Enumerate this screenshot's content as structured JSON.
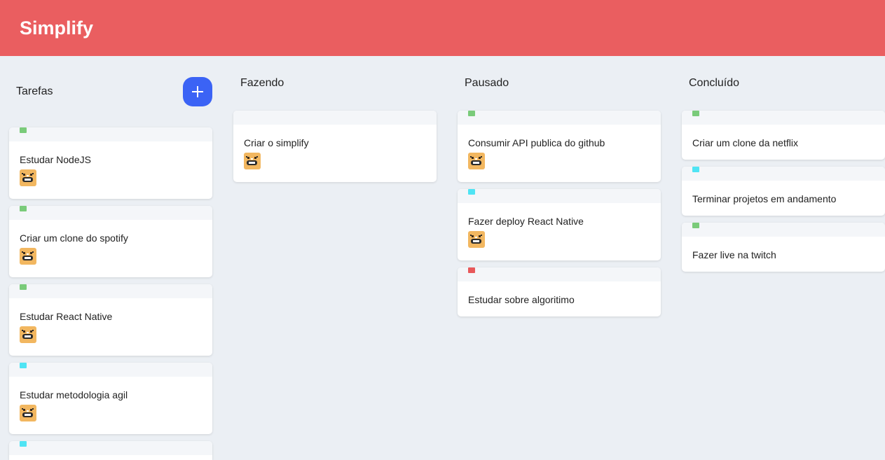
{
  "app": {
    "title": "Simplify"
  },
  "colors": {
    "header": "#ea5e60",
    "background": "#ebeff4",
    "add_button": "#3b63f5",
    "tag_green": "#7acb7a",
    "tag_cyan": "#4fe4f4",
    "tag_red": "#e8585a",
    "avatar": "#f2b760"
  },
  "columns": [
    {
      "title": "Tarefas",
      "add_button_icon": "plus-icon",
      "cards": [
        {
          "text": "Estudar NodeJS",
          "tag": "green",
          "has_avatar": true
        },
        {
          "text": "Criar um clone do spotify",
          "tag": "green",
          "has_avatar": true
        },
        {
          "text": "Estudar React Native",
          "tag": "green",
          "has_avatar": true
        },
        {
          "text": "Estudar metodologia agil",
          "tag": "cyan",
          "has_avatar": true
        },
        {
          "text": "",
          "tag": "cyan",
          "has_avatar": false
        }
      ]
    },
    {
      "title": "Fazendo",
      "cards": [
        {
          "text": "Criar o simplify",
          "tag": "none",
          "has_avatar": true
        }
      ]
    },
    {
      "title": "Pausado",
      "cards": [
        {
          "text": "Consumir API publica do github",
          "tag": "green",
          "has_avatar": true
        },
        {
          "text": "Fazer deploy React Native",
          "tag": "cyan",
          "has_avatar": true
        },
        {
          "text": "Estudar sobre algoritimo",
          "tag": "red",
          "has_avatar": false
        }
      ]
    },
    {
      "title": "Concluído",
      "cards": [
        {
          "text": "Criar um clone da netflix",
          "tag": "green",
          "has_avatar": false
        },
        {
          "text": "Terminar projetos em andamento",
          "tag": "cyan",
          "has_avatar": false
        },
        {
          "text": "Fazer live na twitch",
          "tag": "green",
          "has_avatar": false
        }
      ]
    }
  ]
}
